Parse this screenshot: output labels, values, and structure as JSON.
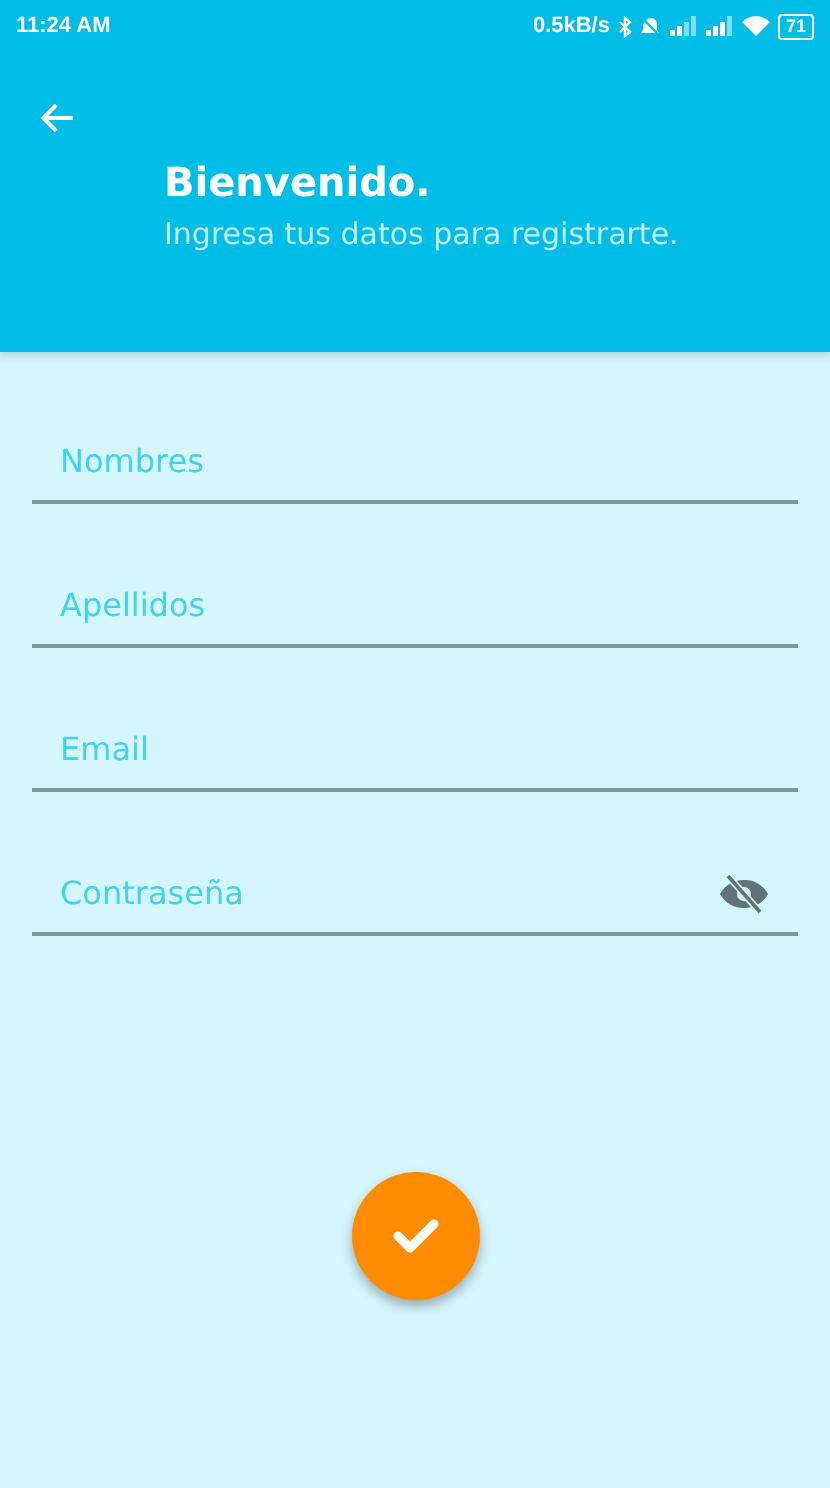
{
  "status_bar": {
    "time": "11:24 AM",
    "network_speed": "0.5kB/s",
    "battery": "71"
  },
  "header": {
    "title": "Bienvenido.",
    "subtitle": "Ingresa tus datos para registrarte."
  },
  "fields": [
    {
      "placeholder": "Nombres",
      "kind": "text"
    },
    {
      "placeholder": "Apellidos",
      "kind": "text"
    },
    {
      "placeholder": "Email",
      "kind": "text"
    },
    {
      "placeholder": "Contraseña",
      "kind": "password"
    }
  ]
}
